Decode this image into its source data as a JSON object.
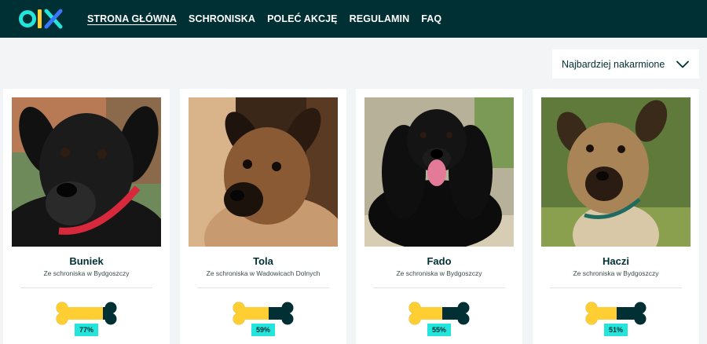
{
  "header": {
    "logo_text": "olx",
    "nav": [
      {
        "label": "STRONA GŁÓWNA",
        "active": true
      },
      {
        "label": "SCHRONISKA",
        "active": false
      },
      {
        "label": "POLEĆ AKCJĘ",
        "active": false
      },
      {
        "label": "REGULAMIN",
        "active": false
      },
      {
        "label": "FAQ",
        "active": false
      }
    ]
  },
  "sort": {
    "selected": "Najbardziej nakarmione",
    "icon": "chevron-down-icon"
  },
  "dogs": [
    {
      "name": "Buniek",
      "shelter": "Ze schroniska w Bydgoszczy",
      "fed_percent": 77,
      "fed_label": "77%"
    },
    {
      "name": "Tola",
      "shelter": "Ze schroniska w Wadowicach Dolnych",
      "fed_percent": 59,
      "fed_label": "59%"
    },
    {
      "name": "Fado",
      "shelter": "Ze schroniska w Bydgoszczy",
      "fed_percent": 55,
      "fed_label": "55%"
    },
    {
      "name": "Haczi",
      "shelter": "Ze schroniska w Bydgoszczy",
      "fed_percent": 51,
      "fed_label": "51%"
    }
  ],
  "colors": {
    "header_bg": "#002f34",
    "accent": "#23e5db",
    "bone_fill": "#ffce32",
    "bone_empty": "#002f34"
  }
}
